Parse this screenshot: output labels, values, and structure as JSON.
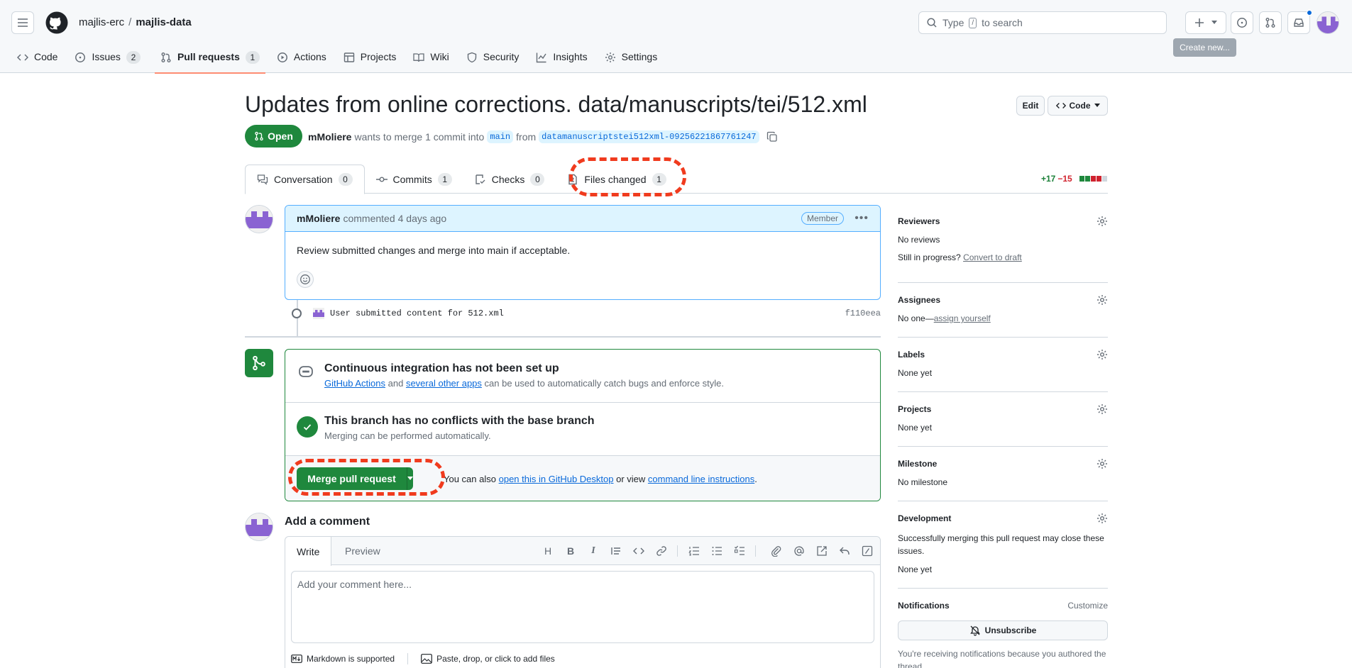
{
  "header": {
    "owner": "majlis-erc",
    "separator": "/",
    "repo": "majlis-data",
    "search_prefix": "Type",
    "search_key": "/",
    "search_suffix": "to search",
    "tooltip": "Create new..."
  },
  "repo_nav": [
    {
      "label": "Code",
      "icon": "code-icon"
    },
    {
      "label": "Issues",
      "icon": "issue-icon",
      "count": "2"
    },
    {
      "label": "Pull requests",
      "icon": "pull-request-icon",
      "count": "1",
      "active": true
    },
    {
      "label": "Actions",
      "icon": "play-icon"
    },
    {
      "label": "Projects",
      "icon": "table-icon"
    },
    {
      "label": "Wiki",
      "icon": "book-icon"
    },
    {
      "label": "Security",
      "icon": "shield-icon"
    },
    {
      "label": "Insights",
      "icon": "graph-icon"
    },
    {
      "label": "Settings",
      "icon": "gear-icon"
    }
  ],
  "pr": {
    "title": "Updates from online corrections. data/manuscripts/tei/512.xml",
    "edit_label": "Edit",
    "code_label": "Code",
    "state": "Open",
    "author": "mMoliere",
    "merge_text_1": "wants to merge 1 commit into",
    "base_branch": "main",
    "merge_text_2": "from",
    "head_branch": "datamanuscriptstei512xml-09256221867761247"
  },
  "tabs": [
    {
      "label": "Conversation",
      "count": "0"
    },
    {
      "label": "Commits",
      "count": "1"
    },
    {
      "label": "Checks",
      "count": "0"
    },
    {
      "label": "Files changed",
      "count": "1"
    }
  ],
  "diffstat": {
    "additions": "+17",
    "deletions": "−15"
  },
  "comment": {
    "author": "mMoliere",
    "action": "commented",
    "time": "4 days ago",
    "badge": "Member",
    "body": "Review submitted changes and merge into main if acceptable."
  },
  "commit": {
    "message": "User submitted content for 512.xml",
    "sha": "f110eea"
  },
  "merge": {
    "ci_title": "Continuous integration has not been set up",
    "ci_link1": "GitHub Actions",
    "ci_and": "and",
    "ci_link2": "several other apps",
    "ci_rest": "can be used to automatically catch bugs and enforce style.",
    "conflict_title": "This branch has no conflicts with the base branch",
    "conflict_sub": "Merging can be performed automatically.",
    "merge_button": "Merge pull request",
    "hint_prefix": "You can also",
    "hint_link1": "open this in GitHub Desktop",
    "hint_mid": "or view",
    "hint_link2": "command line instructions",
    "hint_end": "."
  },
  "add_comment": {
    "title": "Add a comment",
    "tab_write": "Write",
    "tab_preview": "Preview",
    "placeholder": "Add your comment here...",
    "markdown_note": "Markdown is supported",
    "attach_note": "Paste, drop, or click to add files",
    "tool_heading": "H",
    "tool_bold": "B",
    "tool_italic": "I"
  },
  "sidebar": {
    "reviewers": {
      "title": "Reviewers",
      "value": "No reviews",
      "progress_prefix": "Still in progress?",
      "progress_link": "Convert to draft"
    },
    "assignees": {
      "title": "Assignees",
      "value_prefix": "No one—",
      "value_link": "assign yourself"
    },
    "labels": {
      "title": "Labels",
      "value": "None yet"
    },
    "projects": {
      "title": "Projects",
      "value": "None yet"
    },
    "milestone": {
      "title": "Milestone",
      "value": "No milestone"
    },
    "development": {
      "title": "Development",
      "desc": "Successfully merging this pull request may close these issues.",
      "value": "None yet"
    },
    "notifications": {
      "title": "Notifications",
      "customize": "Customize",
      "unsubscribe": "Unsubscribe",
      "note": "You're receiving notifications because you authored the thread."
    }
  },
  "colors": {
    "accent": "#0969da",
    "success": "#1f883d",
    "danger": "#d1242f",
    "annotation": "#f03b1e"
  }
}
